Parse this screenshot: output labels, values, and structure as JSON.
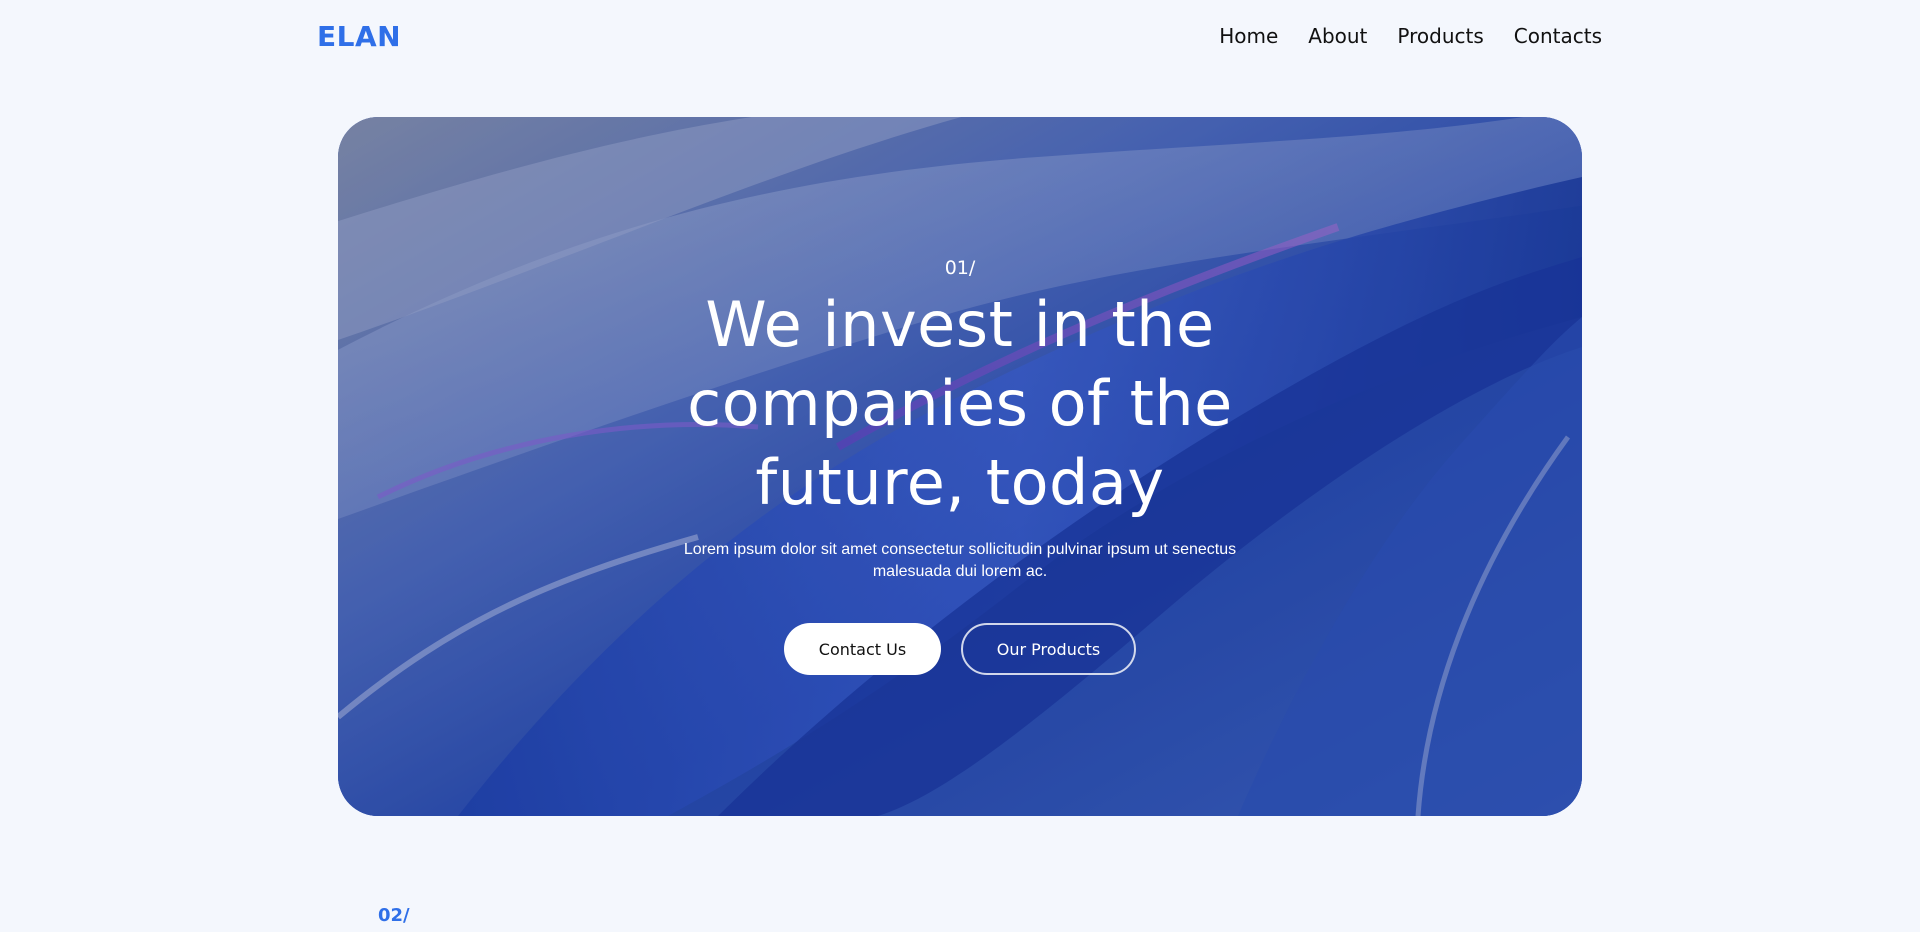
{
  "brand": {
    "logo": "ELAN",
    "accent": "#2f6fe8"
  },
  "nav": {
    "items": [
      "Home",
      "About",
      "Products",
      "Contacts"
    ]
  },
  "hero": {
    "eyebrow": "01/",
    "headline": "We invest in the companies of the future, today",
    "subtext": "Lorem ipsum dolor sit amet consectetur sollicitudin pulvinar ipsum ut senectus malesuada dui lorem ac.",
    "primary_button": "Contact Us",
    "secondary_button": "Our Products"
  },
  "next_section": {
    "number": "02/"
  }
}
